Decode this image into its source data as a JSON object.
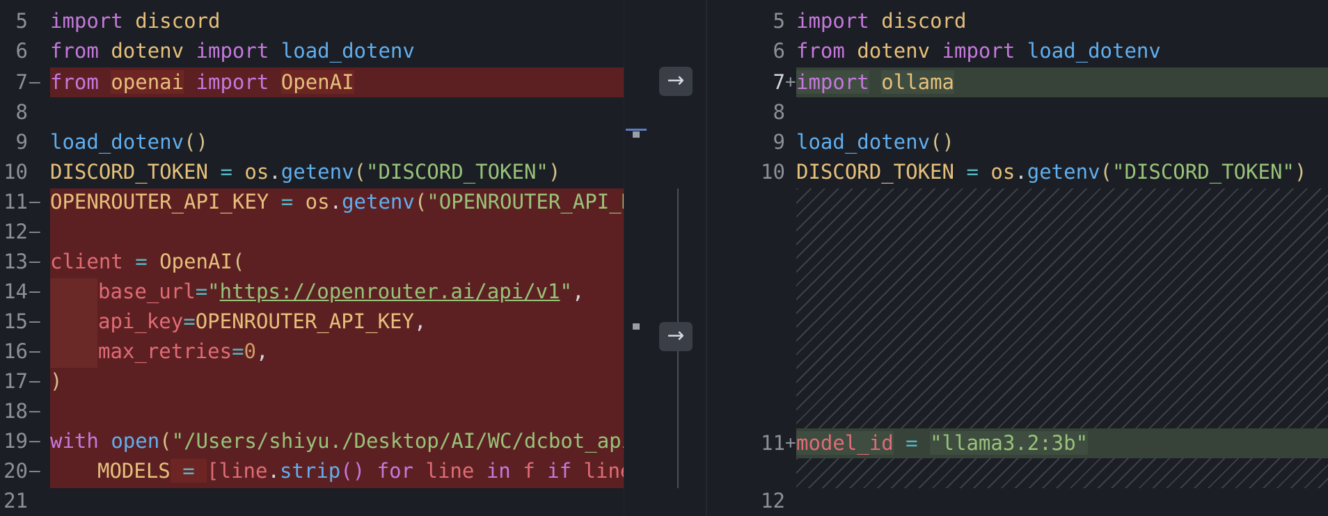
{
  "left": {
    "lines": [
      {
        "num": "5",
        "mark": ""
      },
      {
        "num": "6",
        "mark": ""
      },
      {
        "num": "7",
        "mark": "—"
      },
      {
        "num": "8",
        "mark": ""
      },
      {
        "num": "9",
        "mark": ""
      },
      {
        "num": "10",
        "mark": ""
      },
      {
        "num": "11",
        "mark": "—"
      },
      {
        "num": "12",
        "mark": "—"
      },
      {
        "num": "13",
        "mark": "—"
      },
      {
        "num": "14",
        "mark": "—"
      },
      {
        "num": "15",
        "mark": "—"
      },
      {
        "num": "16",
        "mark": "—"
      },
      {
        "num": "17",
        "mark": "—"
      },
      {
        "num": "18",
        "mark": "—"
      },
      {
        "num": "19",
        "mark": "—"
      },
      {
        "num": "20",
        "mark": "—"
      },
      {
        "num": "21",
        "mark": ""
      }
    ],
    "tokens": {
      "l5": [
        "import",
        " ",
        "discord"
      ],
      "l6": [
        "from",
        " ",
        "dotenv",
        " ",
        "import",
        " ",
        "load_dotenv"
      ],
      "l7": [
        "from",
        " ",
        "openai",
        " ",
        "import",
        " ",
        "OpenAI"
      ],
      "l9": [
        "load_dotenv",
        "()"
      ],
      "l10": [
        "DISCORD_TOKEN",
        " = ",
        "os",
        ".",
        "getenv",
        "(",
        "\"DISCORD_TOKEN\"",
        ")"
      ],
      "l11": [
        "OPENROUTER_API_KEY",
        " = ",
        "os",
        ".",
        "getenv",
        "(",
        "\"OPENROUTER_API_KEY"
      ],
      "l13": [
        "client",
        " = ",
        "OpenAI",
        "("
      ],
      "l14": [
        "base_url",
        "=",
        "\"",
        "https://openrouter.ai/api/v1",
        "\"",
        ","
      ],
      "l15": [
        "api_key",
        "=",
        "OPENROUTER_API_KEY",
        ","
      ],
      "l16": [
        "max_retries",
        "=",
        "0",
        ","
      ],
      "l17": [
        ")"
      ],
      "l19": [
        "with",
        " ",
        "open",
        "(",
        "\"/Users/shiyu./Desktop/AI/WC/dcbot_api/m"
      ],
      "l20": [
        "MODELS",
        " = ",
        "[",
        "line",
        ".",
        "strip",
        "()",
        " ",
        "for",
        " ",
        "line",
        " ",
        "in",
        " ",
        "f",
        " ",
        "if",
        " ",
        "line",
        ".s"
      ]
    }
  },
  "right": {
    "lines": [
      {
        "num": "5",
        "mark": ""
      },
      {
        "num": "6",
        "mark": ""
      },
      {
        "num": "7",
        "mark": "+"
      },
      {
        "num": "8",
        "mark": ""
      },
      {
        "num": "9",
        "mark": ""
      },
      {
        "num": "10",
        "mark": ""
      },
      {
        "num": "11",
        "mark": "+"
      },
      {
        "num": "12",
        "mark": ""
      }
    ],
    "tokens": {
      "l5": [
        "import",
        " ",
        "discord"
      ],
      "l6": [
        "from",
        " ",
        "dotenv",
        " ",
        "import",
        " ",
        "load_dotenv"
      ],
      "l7": [
        "import",
        " ",
        "ollama"
      ],
      "l9": [
        "load_dotenv",
        "()"
      ],
      "l10": [
        "DISCORD_TOKEN",
        " = ",
        "os",
        ".",
        "getenv",
        "(",
        "\"DISCORD_TOKEN\"",
        ")"
      ],
      "l11": [
        "model_id",
        " = ",
        "\"llama3.2:3b\""
      ]
    }
  },
  "controls": {
    "revert_chunk_1_icon": "→",
    "revert_chunk_2_icon": "→"
  },
  "icons": [
    "arrow-right-icon"
  ],
  "colors": {
    "background": "#1b1e24",
    "deleted": "#5d2022",
    "added": "#374238",
    "keyword": "#c679dd",
    "function": "#61afef",
    "identifier": "#e6c07b",
    "string": "#98c379"
  }
}
